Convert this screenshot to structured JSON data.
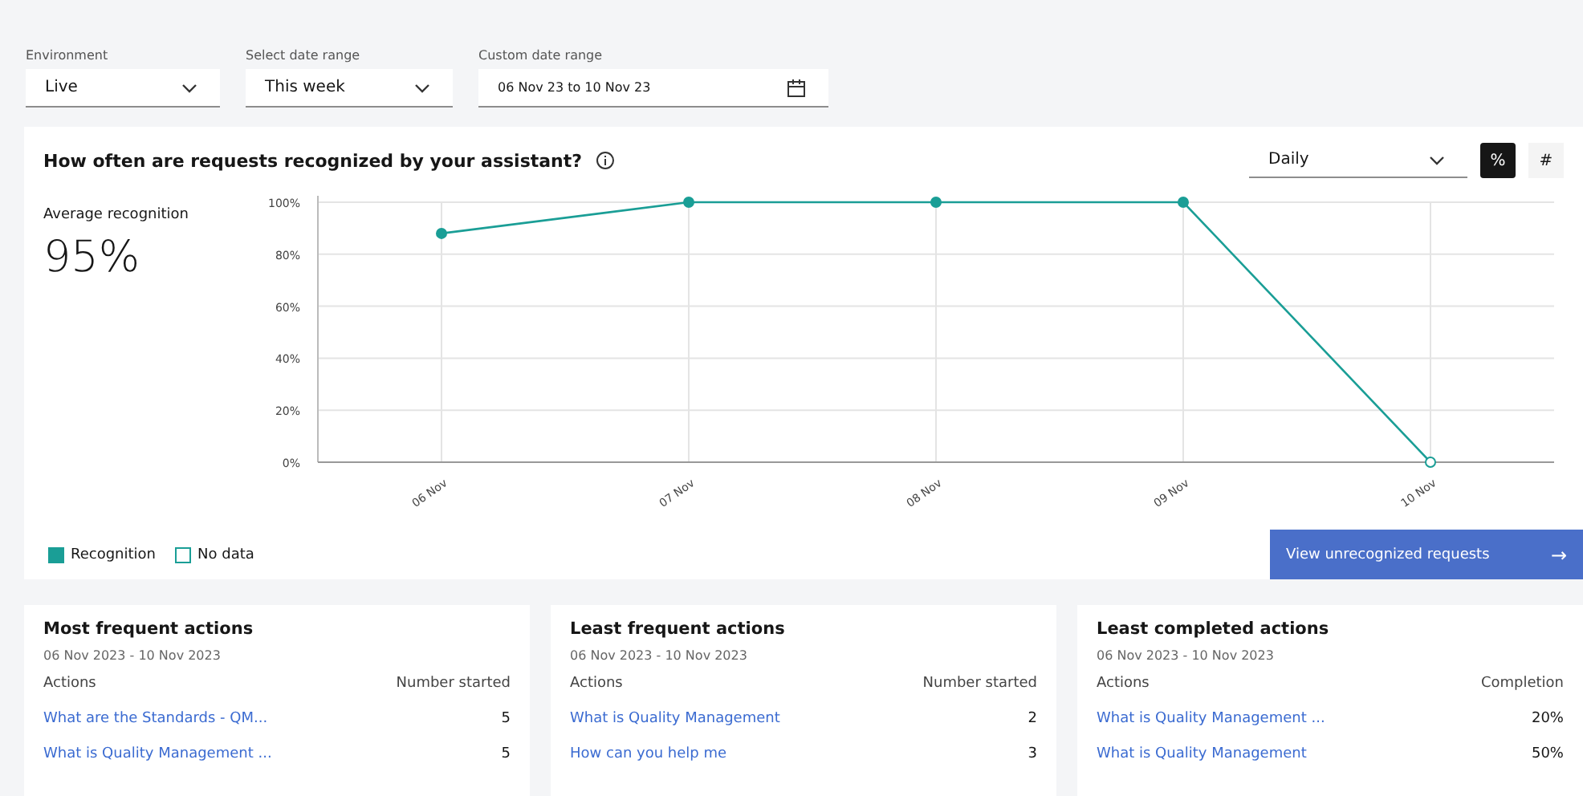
{
  "filters": [
    {
      "label": "Environment",
      "value": "Live",
      "kind": "dropdown"
    },
    {
      "label": "Select date range",
      "value": "This week",
      "kind": "dropdown"
    },
    {
      "label": "Custom date range",
      "value": "06 Nov 23 to 10 Nov 23",
      "kind": "date"
    }
  ],
  "recognition": {
    "title": "How often are requests recognized by your assistant?",
    "interval": "Daily",
    "toggles": [
      {
        "label": "%",
        "selected": true
      },
      {
        "label": "#",
        "selected": false
      }
    ],
    "metric_label": "Average recognition",
    "metric_value": "95%",
    "chart_data": {
      "type": "line",
      "grid": true,
      "categories": [
        "06 Nov",
        "07 Nov",
        "08 Nov",
        "09 Nov",
        "10 Nov"
      ],
      "ylim": [
        0,
        100
      ],
      "yticks": [
        {
          "value": 0,
          "label": "0%"
        },
        {
          "value": 20,
          "label": "20%"
        },
        {
          "value": 40,
          "label": "40%"
        },
        {
          "value": 60,
          "label": "60%"
        },
        {
          "value": 80,
          "label": "80%"
        },
        {
          "value": 100,
          "label": "100%"
        }
      ],
      "series": [
        {
          "name": "Recognition",
          "color": "#1a9e96",
          "marker": "circle",
          "values": [
            88,
            100,
            100,
            100,
            0
          ]
        }
      ]
    },
    "legend": [
      {
        "label": "No data",
        "kind": "outline"
      }
    ],
    "button": "View unrecognized requests",
    "button_icon": "→"
  },
  "cards": [
    {
      "title": "Most frequent actions",
      "dates": "06 Nov 2023 - 10 Nov 2023",
      "columns": [
        "Actions",
        "Number started"
      ],
      "rows": [
        [
          "What are the Standards - QM...",
          "5"
        ],
        [
          "What is Quality Management ...",
          "5"
        ]
      ]
    },
    {
      "title": "Least frequent actions",
      "dates": "06 Nov 2023 - 10 Nov 2023",
      "columns": [
        "Actions",
        "Number started"
      ],
      "rows": [
        [
          "What is Quality Management",
          "2"
        ],
        [
          "How can you help me",
          "3"
        ]
      ]
    },
    {
      "title": "Least completed actions",
      "dates": "06 Nov 2023 - 10 Nov 2023",
      "columns": [
        "Actions",
        "Completion"
      ],
      "rows": [
        [
          "What is Quality Management ...",
          "20%"
        ],
        [
          "What is Quality Management",
          "50%"
        ]
      ]
    }
  ]
}
